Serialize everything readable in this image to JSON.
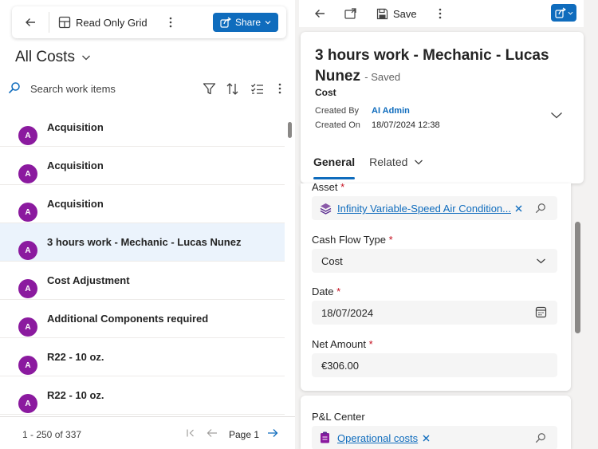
{
  "left": {
    "toolbar": {
      "grid_label": "Read Only Grid",
      "share_label": "Share"
    },
    "view_title": "All Costs",
    "search": {
      "placeholder": "Search work items"
    },
    "items": [
      {
        "initial": "A",
        "label": "Acquisition"
      },
      {
        "initial": "A",
        "label": "Acquisition"
      },
      {
        "initial": "A",
        "label": "Acquisition"
      },
      {
        "initial": "A",
        "label": "3 hours work - Mechanic - Lucas Nunez",
        "selected": true
      },
      {
        "initial": "A",
        "label": "Cost Adjustment"
      },
      {
        "initial": "A",
        "label": "Additional Components required"
      },
      {
        "initial": "A",
        "label": "R22 - 10 oz."
      },
      {
        "initial": "A",
        "label": "R22 - 10 oz."
      }
    ],
    "footer": {
      "count": "1 - 250 of 337",
      "page": "Page 1"
    }
  },
  "right": {
    "toolbar": {
      "save_label": "Save"
    },
    "header": {
      "title": "3 hours work - Mechanic - Lucas Nunez",
      "status": "- Saved",
      "entity": "Cost",
      "created_by_label": "Created By",
      "created_by_value": "AI Admin",
      "created_on_label": "Created On",
      "created_on_value": "18/07/2024 12:38"
    },
    "tabs": [
      {
        "label": "General",
        "active": true
      },
      {
        "label": "Related",
        "active": false
      }
    ],
    "fields": {
      "asset": {
        "label": "Asset",
        "value": "Infinity Variable-Speed Air Condition..."
      },
      "cash_flow_type": {
        "label": "Cash Flow Type",
        "value": "Cost"
      },
      "date": {
        "label": "Date",
        "value": "18/07/2024"
      },
      "net_amount": {
        "label": "Net Amount",
        "value": "€306.00"
      },
      "pl_center": {
        "label": "P&L Center",
        "value": "Operational costs"
      }
    },
    "required_marker": "*"
  },
  "colors": {
    "accent": "#0f6cbd",
    "avatar": "#8b1a9f",
    "required": "#c50f1f",
    "selected_row": "#ebf3fc"
  }
}
